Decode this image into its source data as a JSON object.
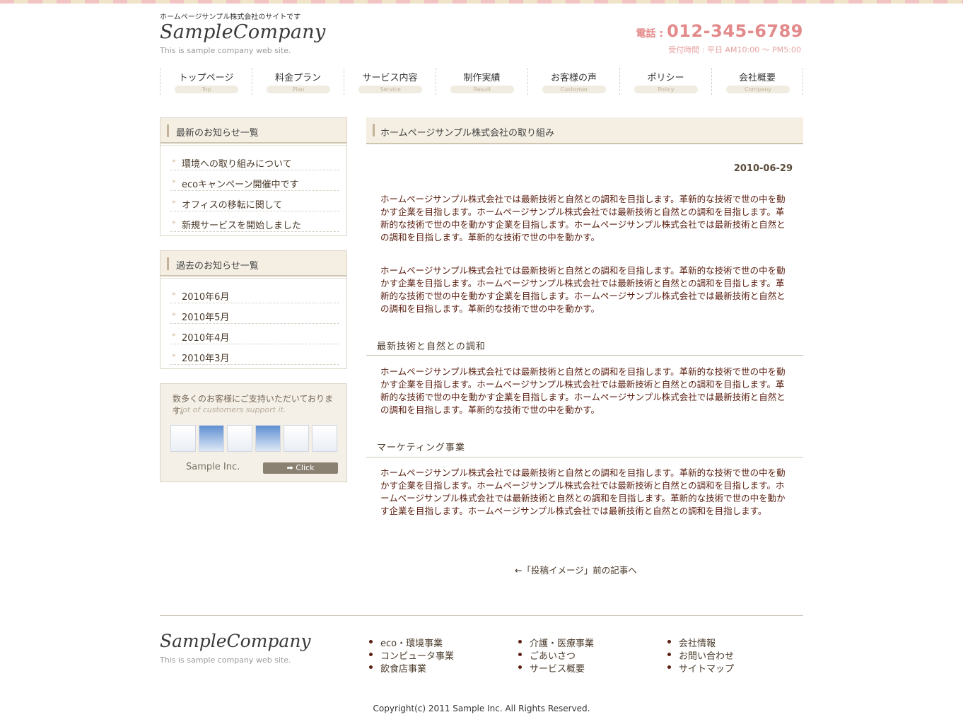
{
  "header": {
    "tagline": "ホームページサンプル株式会社のサイトです",
    "logo": "SampleCompany",
    "logo_sub": "This is sample company web site.",
    "phone_label": "電話 :",
    "phone_number": "012-345-6789",
    "hours": "受付時間 : 平日 AM10:00 〜 PM5:00"
  },
  "nav": [
    {
      "label": "トップページ",
      "sub": "Top"
    },
    {
      "label": "料金プラン",
      "sub": "Plan"
    },
    {
      "label": "サービス内容",
      "sub": "Service"
    },
    {
      "label": "制作実績",
      "sub": "Result"
    },
    {
      "label": "お客様の声",
      "sub": "Customer"
    },
    {
      "label": "ポリシー",
      "sub": "Policy"
    },
    {
      "label": "会社概要",
      "sub": "Company"
    }
  ],
  "sidebar": {
    "latest_title": "最新のお知らせ一覧",
    "latest": [
      "環境への取り組みについて",
      "ecoキャンペーン開催中です",
      "オフィスの移転に関して",
      "新規サービスを開始しました"
    ],
    "past_title": "過去のお知らせ一覧",
    "past": [
      "2010年6月",
      "2010年5月",
      "2010年4月",
      "2010年3月"
    ],
    "list_mark": "»",
    "banner": {
      "title": "数多くのお客様にご支持いただいております。",
      "en": "A lot of customers support it.",
      "brand": "Sample Inc.",
      "click": "➡ Click"
    }
  },
  "main": {
    "title": "ホームページサンプル株式会社の取り組み",
    "date": "2010-06-29",
    "paragraphs": [
      "ホームページサンプル株式会社では最新技術と自然との調和を目指します。革新的な技術で世の中を動かす企業を目指します。ホームページサンプル株式会社では最新技術と自然との調和を目指します。革新的な技術で世の中を動かす企業を目指します。ホームページサンプル株式会社では最新技術と自然との調和を目指します。革新的な技術で世の中を動かす。",
      "ホームページサンプル株式会社では最新技術と自然との調和を目指します。革新的な技術で世の中を動かす企業を目指します。ホームページサンプル株式会社では最新技術と自然との調和を目指します。革新的な技術で世の中を動かす企業を目指します。ホームページサンプル株式会社では最新技術と自然との調和を目指します。革新的な技術で世の中を動かす。",
      "ホームページサンプル株式会社では最新技術と自然との調和を目指します。革新的な技術で世の中を動かす企業を目指します。ホームページサンプル株式会社では最新技術と自然との調和を目指します。革新的な技術で世の中を動かす企業を目指します。ホームページサンプル株式会社では最新技術と自然との調和を目指します。革新的な技術で世の中を動かす。",
      "ホームページサンプル株式会社では最新技術と自然との調和を目指します。革新的な技術で世の中を動かす企業を目指します。ホームページサンプル株式会社では最新技術と自然との調和を目指します。ホームページサンプル株式会社では最新技術と自然との調和を目指します。革新的な技術で世の中を動かす企業を目指します。ホームページサンプル株式会社では最新技術と自然との調和を目指します。"
    ],
    "subhead1": "最新技術と自然との調和",
    "subhead2": "マーケティング事業",
    "prev_link": "←「投稿イメージ」前の記事へ"
  },
  "footer": {
    "logo": "SampleCompany",
    "logo_sub": "This is sample company web site.",
    "col1": [
      "eco・環境事業",
      "コンピュータ事業",
      "飲食店事業"
    ],
    "col2": [
      "介護・医療事業",
      "ごあいさつ",
      "サービス概要"
    ],
    "col3": [
      "会社情報",
      "お問い合わせ",
      "サイトマップ"
    ],
    "copyright": "Copyright(c) 2011 Sample Inc. All Rights Reserved."
  },
  "colors": {
    "accent": "#e38a8a",
    "panel": "#f5efe3",
    "body_text": "#5a1e10"
  }
}
